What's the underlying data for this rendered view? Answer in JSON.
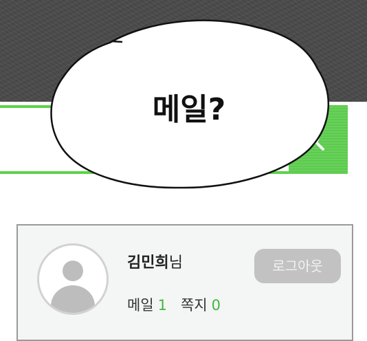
{
  "speech_bubble": {
    "text": "메일?"
  },
  "search": {
    "placeholder": "",
    "icon": "search-icon",
    "accent_color": "#5dd34a"
  },
  "user_card": {
    "name": "김민희",
    "honorific": "님",
    "logout_label": "로그아웃",
    "mail_label": "메일",
    "mail_count": "1",
    "note_label": "쪽지",
    "note_count": "0",
    "count_color": "#3fb83f",
    "avatar_icon": "user-avatar-icon"
  }
}
